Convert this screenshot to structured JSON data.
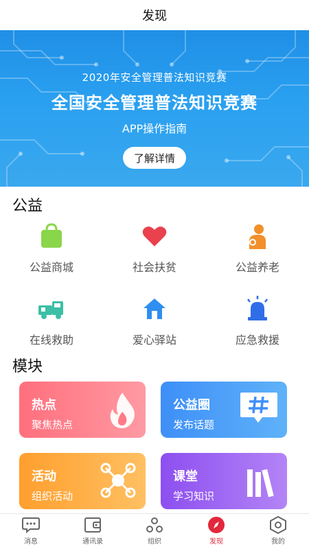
{
  "header": {
    "title": "发现"
  },
  "banner": {
    "subtitle": "2020年安全管理普法知识竞赛",
    "title": "全国安全管理普法知识竞赛",
    "guide": "APP操作指南",
    "button_label": "了解详情"
  },
  "sections": {
    "public_welfare": "公益",
    "modules": "模块"
  },
  "welfare_items": [
    {
      "label": "公益商城",
      "icon": "shopping-bag-icon"
    },
    {
      "label": "社会扶贫",
      "icon": "heart-icon"
    },
    {
      "label": "公益养老",
      "icon": "elder-care-icon"
    },
    {
      "label": "在线救助",
      "icon": "tow-truck-icon"
    },
    {
      "label": "爱心驿站",
      "icon": "house-icon"
    },
    {
      "label": "应急救援",
      "icon": "siren-icon"
    }
  ],
  "module_cards": [
    {
      "title": "热点",
      "subtitle": "聚焦热点",
      "icon": "flame-icon",
      "color": "#ff7a86"
    },
    {
      "title": "公益圈",
      "subtitle": "发布话题",
      "icon": "hashtag-icon",
      "color": "#3e8ff7"
    },
    {
      "title": "活动",
      "subtitle": "组织活动",
      "icon": "network-icon",
      "color": "#ffa63e"
    },
    {
      "title": "课堂",
      "subtitle": "学习知识",
      "icon": "books-icon",
      "color": "#9a5cf0"
    }
  ],
  "tabbar": [
    {
      "label": "消息",
      "icon": "message-icon",
      "active": false
    },
    {
      "label": "通讯录",
      "icon": "contacts-icon",
      "active": false
    },
    {
      "label": "组织",
      "icon": "organization-icon",
      "active": false
    },
    {
      "label": "发现",
      "icon": "compass-icon",
      "active": true
    },
    {
      "label": "我的",
      "icon": "profile-icon",
      "active": false
    }
  ],
  "colors": {
    "accent": "#e2283c",
    "banner": "#2aa0f0"
  }
}
